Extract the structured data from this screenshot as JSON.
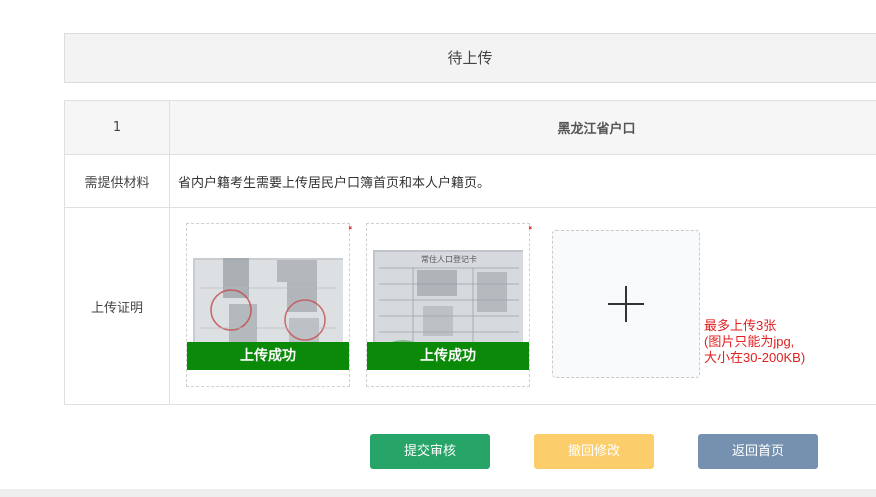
{
  "status_header": {
    "text": "待上传"
  },
  "table": {
    "index": "1",
    "region": "黑龙江省户口",
    "materials_label": "需提供材料",
    "materials_text": "省内户籍考生需要上传居民户口簿首页和本人户籍页。",
    "upload_label": "上传证明"
  },
  "uploads": [
    {
      "status": "上传成功"
    },
    {
      "status": "上传成功",
      "card_heading": "常住人口登记卡"
    }
  ],
  "upload_hint": {
    "line1": "最多上传3张",
    "line2": "(图片只能为jpg,",
    "line3": "大小在30-200KB)"
  },
  "buttons": {
    "submit": "提交审核",
    "withdraw": "撤回修改",
    "home": "返回首页"
  },
  "colors": {
    "success_green": "#0a8a08",
    "hint_red": "#e02020",
    "submit_green": "#27a468",
    "withdraw_yellow": "#fcce6b",
    "home_blue": "#7691b0"
  }
}
